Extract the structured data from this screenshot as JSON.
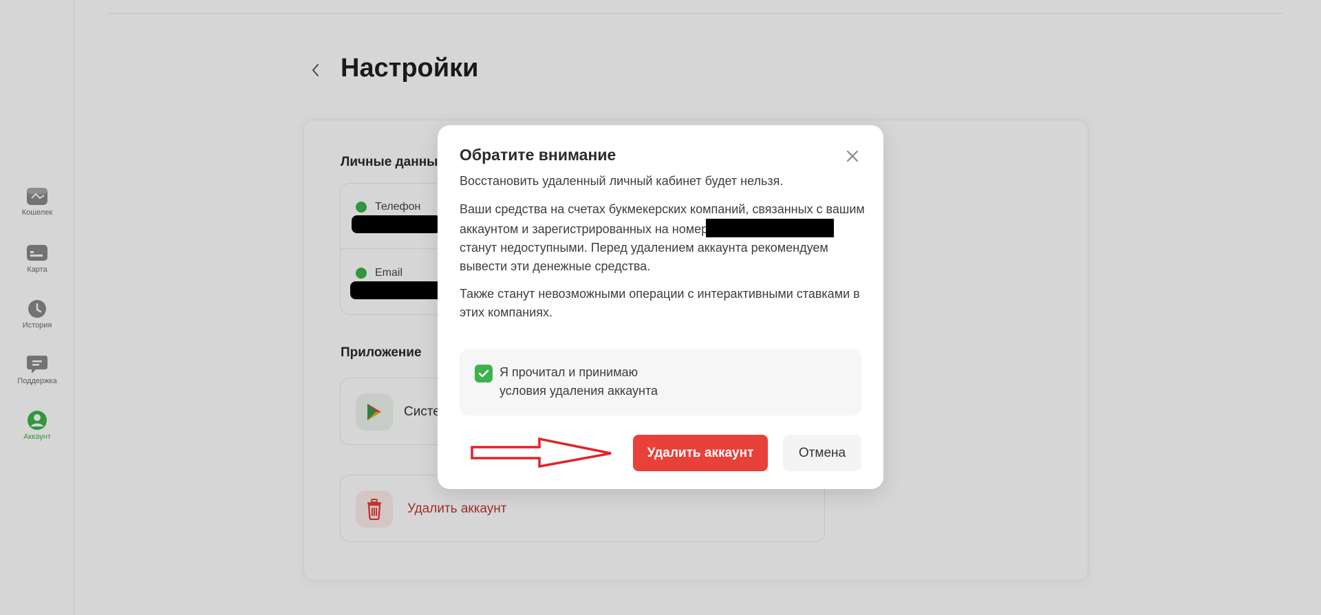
{
  "sidebar": {
    "items": [
      {
        "label": "Кошелек",
        "icon": "wallet-icon",
        "active": false
      },
      {
        "label": "Карта",
        "icon": "card-icon",
        "active": false
      },
      {
        "label": "История",
        "icon": "clock-icon",
        "active": false
      },
      {
        "label": "Поддержка",
        "icon": "chat-icon",
        "active": false
      },
      {
        "label": "Аккаунт",
        "icon": "user-icon",
        "active": true
      }
    ]
  },
  "page": {
    "title": "Настройки",
    "personal_section_title": "Личные данные",
    "phone_label": "Телефон",
    "email_label": "Email",
    "app_section_title": "Приложение",
    "app_item_label": "Системное",
    "delete_item_label": "Удалить аккаунт"
  },
  "modal": {
    "title": "Обратите внимание",
    "subtitle": "Восстановить удаленный личный кабинет будет нельзя.",
    "para1_start": "Ваши средства на счетах букмекерских компаний, связанных с вашим аккаунтом и зарегистрированных на номер",
    "para1_end": "станут недоступными. Перед удалением аккаунта рекомендуем вывести эти денежные средства.",
    "para2": "Также станут невозможными операции с интерактивными ставками в этих компаниях.",
    "consent_line1": "Я прочитал и принимаю",
    "consent_line2": "условия удаления аккаунта",
    "consent_checked": true,
    "delete_button": "Удалить аккаунт",
    "cancel_button": "Отмена"
  },
  "colors": {
    "accent_green": "#3bb34a",
    "danger_red": "#e8413a",
    "annotation_red": "#e0242a"
  }
}
